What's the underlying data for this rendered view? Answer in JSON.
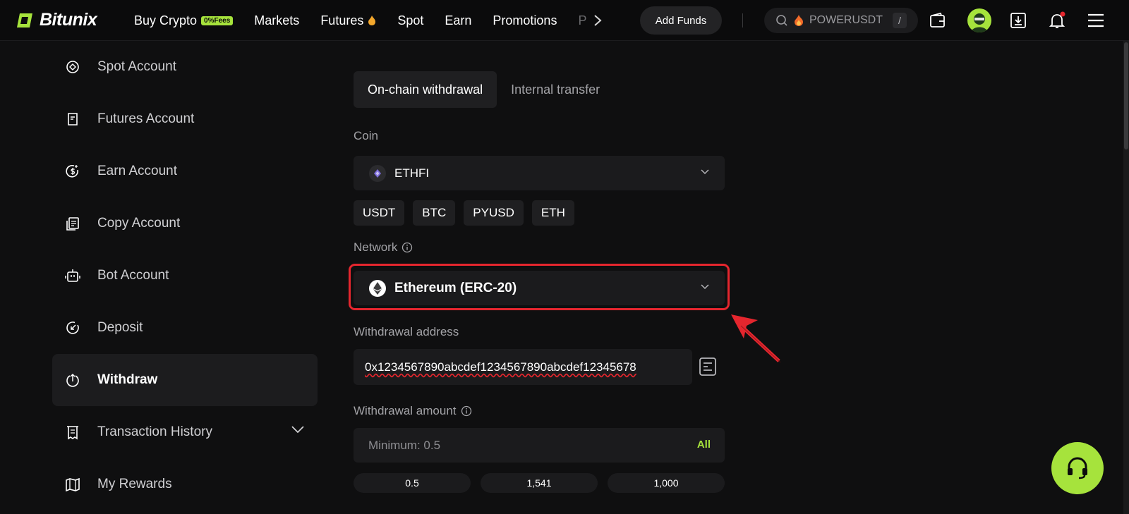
{
  "brand": {
    "name": "Bitunix",
    "accent": "#a6e33c",
    "alert_red": "#e5262e"
  },
  "nav": {
    "items": [
      {
        "label": "Buy Crypto",
        "badge": "0%Fees"
      },
      {
        "label": "Markets"
      },
      {
        "label": "Futures",
        "icon": "flame-icon"
      },
      {
        "label": "Spot"
      },
      {
        "label": "Earn"
      },
      {
        "label": "Promotions"
      }
    ],
    "overflow_label": "P",
    "add_funds": "Add Funds",
    "search_text": "POWERUSDT",
    "search_shortcut": "/"
  },
  "sidebar": {
    "items": [
      {
        "label": "Spot Account",
        "icon": "spot-account-icon"
      },
      {
        "label": "Futures Account",
        "icon": "futures-account-icon"
      },
      {
        "label": "Earn Account",
        "icon": "earn-account-icon"
      },
      {
        "label": "Copy Account",
        "icon": "copy-account-icon"
      },
      {
        "label": "Bot Account",
        "icon": "bot-account-icon"
      },
      {
        "label": "Deposit",
        "icon": "deposit-icon"
      },
      {
        "label": "Withdraw",
        "icon": "withdraw-icon",
        "active": true
      },
      {
        "label": "Transaction History",
        "icon": "transaction-history-icon"
      },
      {
        "label": "My Rewards",
        "icon": "rewards-icon"
      }
    ]
  },
  "form": {
    "tabs": [
      {
        "label": "On-chain withdrawal",
        "active": true
      },
      {
        "label": "Internal transfer"
      }
    ],
    "coin_label": "Coin",
    "coin_value": "ETHFI",
    "quick_coins": [
      "USDT",
      "BTC",
      "PYUSD",
      "ETH"
    ],
    "network_label": "Network",
    "network_value": "Ethereum (ERC-20)",
    "address_label": "Withdrawal address",
    "address_value": "0x1234567890abcdef1234567890abcdef12345678",
    "amount_label": "Withdrawal amount",
    "amount_placeholder": "Minimum: 0.5",
    "amount_all": "All",
    "quick_amounts": [
      "0.5",
      "1,541",
      "1,000"
    ]
  }
}
